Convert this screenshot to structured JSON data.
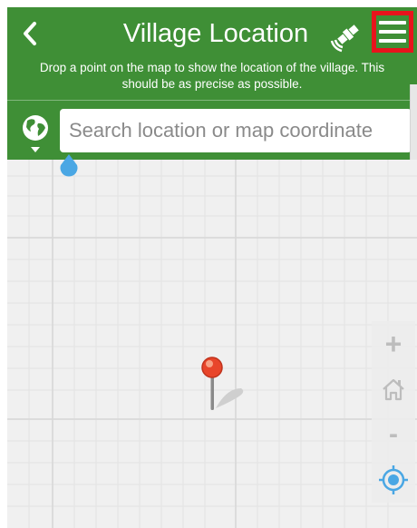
{
  "header": {
    "title": "Village Location",
    "description_line1": "Drop a point on the map to show the location of the village. This",
    "description_line2": "should be as precise as possible.",
    "back_icon": "chevron-left-icon",
    "gps_icon": "satellite-icon",
    "menu_icon": "hamburger-menu-icon"
  },
  "search": {
    "placeholder": "Search location or map coordinate",
    "value": "",
    "globe_icon": "globe-icon"
  },
  "map_controls": {
    "zoom_in_label": "+",
    "home_icon": "home-icon",
    "zoom_out_label": "-",
    "locate_icon": "locate-icon"
  },
  "colors": {
    "header_green": "#3f8f36",
    "highlight_red": "#e8141c",
    "accent_blue": "#4aa7e4",
    "pin_red": "#e8452a"
  }
}
